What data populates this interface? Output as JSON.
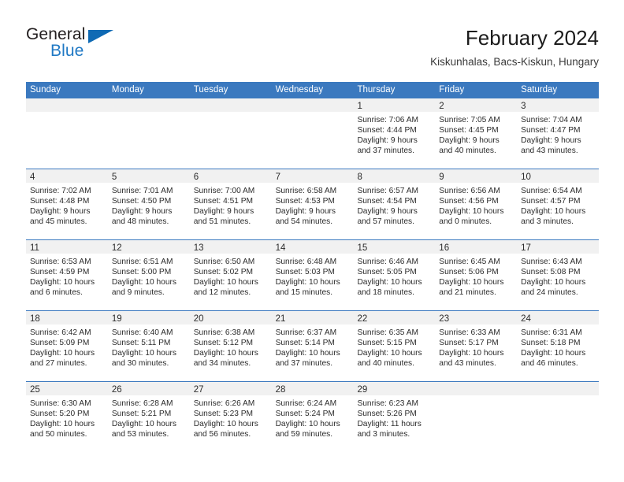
{
  "brand": {
    "name_part1": "General",
    "name_part2": "Blue",
    "flag_icon": "triangle-flag-icon"
  },
  "header": {
    "title": "February 2024",
    "location": "Kiskunhalas, Bacs-Kiskun, Hungary"
  },
  "colors": {
    "header_blue": "#3b79bf",
    "brand_blue": "#2079c4",
    "daynum_band": "#f1f1f1",
    "text": "#2b2b2b"
  },
  "weekday_headers": [
    "Sunday",
    "Monday",
    "Tuesday",
    "Wednesday",
    "Thursday",
    "Friday",
    "Saturday"
  ],
  "weeks": [
    [
      {
        "day": "",
        "lines": []
      },
      {
        "day": "",
        "lines": []
      },
      {
        "day": "",
        "lines": []
      },
      {
        "day": "",
        "lines": []
      },
      {
        "day": "1",
        "lines": [
          "Sunrise: 7:06 AM",
          "Sunset: 4:44 PM",
          "Daylight: 9 hours",
          "and 37 minutes."
        ]
      },
      {
        "day": "2",
        "lines": [
          "Sunrise: 7:05 AM",
          "Sunset: 4:45 PM",
          "Daylight: 9 hours",
          "and 40 minutes."
        ]
      },
      {
        "day": "3",
        "lines": [
          "Sunrise: 7:04 AM",
          "Sunset: 4:47 PM",
          "Daylight: 9 hours",
          "and 43 minutes."
        ]
      }
    ],
    [
      {
        "day": "4",
        "lines": [
          "Sunrise: 7:02 AM",
          "Sunset: 4:48 PM",
          "Daylight: 9 hours",
          "and 45 minutes."
        ]
      },
      {
        "day": "5",
        "lines": [
          "Sunrise: 7:01 AM",
          "Sunset: 4:50 PM",
          "Daylight: 9 hours",
          "and 48 minutes."
        ]
      },
      {
        "day": "6",
        "lines": [
          "Sunrise: 7:00 AM",
          "Sunset: 4:51 PM",
          "Daylight: 9 hours",
          "and 51 minutes."
        ]
      },
      {
        "day": "7",
        "lines": [
          "Sunrise: 6:58 AM",
          "Sunset: 4:53 PM",
          "Daylight: 9 hours",
          "and 54 minutes."
        ]
      },
      {
        "day": "8",
        "lines": [
          "Sunrise: 6:57 AM",
          "Sunset: 4:54 PM",
          "Daylight: 9 hours",
          "and 57 minutes."
        ]
      },
      {
        "day": "9",
        "lines": [
          "Sunrise: 6:56 AM",
          "Sunset: 4:56 PM",
          "Daylight: 10 hours",
          "and 0 minutes."
        ]
      },
      {
        "day": "10",
        "lines": [
          "Sunrise: 6:54 AM",
          "Sunset: 4:57 PM",
          "Daylight: 10 hours",
          "and 3 minutes."
        ]
      }
    ],
    [
      {
        "day": "11",
        "lines": [
          "Sunrise: 6:53 AM",
          "Sunset: 4:59 PM",
          "Daylight: 10 hours",
          "and 6 minutes."
        ]
      },
      {
        "day": "12",
        "lines": [
          "Sunrise: 6:51 AM",
          "Sunset: 5:00 PM",
          "Daylight: 10 hours",
          "and 9 minutes."
        ]
      },
      {
        "day": "13",
        "lines": [
          "Sunrise: 6:50 AM",
          "Sunset: 5:02 PM",
          "Daylight: 10 hours",
          "and 12 minutes."
        ]
      },
      {
        "day": "14",
        "lines": [
          "Sunrise: 6:48 AM",
          "Sunset: 5:03 PM",
          "Daylight: 10 hours",
          "and 15 minutes."
        ]
      },
      {
        "day": "15",
        "lines": [
          "Sunrise: 6:46 AM",
          "Sunset: 5:05 PM",
          "Daylight: 10 hours",
          "and 18 minutes."
        ]
      },
      {
        "day": "16",
        "lines": [
          "Sunrise: 6:45 AM",
          "Sunset: 5:06 PM",
          "Daylight: 10 hours",
          "and 21 minutes."
        ]
      },
      {
        "day": "17",
        "lines": [
          "Sunrise: 6:43 AM",
          "Sunset: 5:08 PM",
          "Daylight: 10 hours",
          "and 24 minutes."
        ]
      }
    ],
    [
      {
        "day": "18",
        "lines": [
          "Sunrise: 6:42 AM",
          "Sunset: 5:09 PM",
          "Daylight: 10 hours",
          "and 27 minutes."
        ]
      },
      {
        "day": "19",
        "lines": [
          "Sunrise: 6:40 AM",
          "Sunset: 5:11 PM",
          "Daylight: 10 hours",
          "and 30 minutes."
        ]
      },
      {
        "day": "20",
        "lines": [
          "Sunrise: 6:38 AM",
          "Sunset: 5:12 PM",
          "Daylight: 10 hours",
          "and 34 minutes."
        ]
      },
      {
        "day": "21",
        "lines": [
          "Sunrise: 6:37 AM",
          "Sunset: 5:14 PM",
          "Daylight: 10 hours",
          "and 37 minutes."
        ]
      },
      {
        "day": "22",
        "lines": [
          "Sunrise: 6:35 AM",
          "Sunset: 5:15 PM",
          "Daylight: 10 hours",
          "and 40 minutes."
        ]
      },
      {
        "day": "23",
        "lines": [
          "Sunrise: 6:33 AM",
          "Sunset: 5:17 PM",
          "Daylight: 10 hours",
          "and 43 minutes."
        ]
      },
      {
        "day": "24",
        "lines": [
          "Sunrise: 6:31 AM",
          "Sunset: 5:18 PM",
          "Daylight: 10 hours",
          "and 46 minutes."
        ]
      }
    ],
    [
      {
        "day": "25",
        "lines": [
          "Sunrise: 6:30 AM",
          "Sunset: 5:20 PM",
          "Daylight: 10 hours",
          "and 50 minutes."
        ]
      },
      {
        "day": "26",
        "lines": [
          "Sunrise: 6:28 AM",
          "Sunset: 5:21 PM",
          "Daylight: 10 hours",
          "and 53 minutes."
        ]
      },
      {
        "day": "27",
        "lines": [
          "Sunrise: 6:26 AM",
          "Sunset: 5:23 PM",
          "Daylight: 10 hours",
          "and 56 minutes."
        ]
      },
      {
        "day": "28",
        "lines": [
          "Sunrise: 6:24 AM",
          "Sunset: 5:24 PM",
          "Daylight: 10 hours",
          "and 59 minutes."
        ]
      },
      {
        "day": "29",
        "lines": [
          "Sunrise: 6:23 AM",
          "Sunset: 5:26 PM",
          "Daylight: 11 hours",
          "and 3 minutes."
        ]
      },
      {
        "day": "",
        "lines": []
      },
      {
        "day": "",
        "lines": []
      }
    ]
  ]
}
